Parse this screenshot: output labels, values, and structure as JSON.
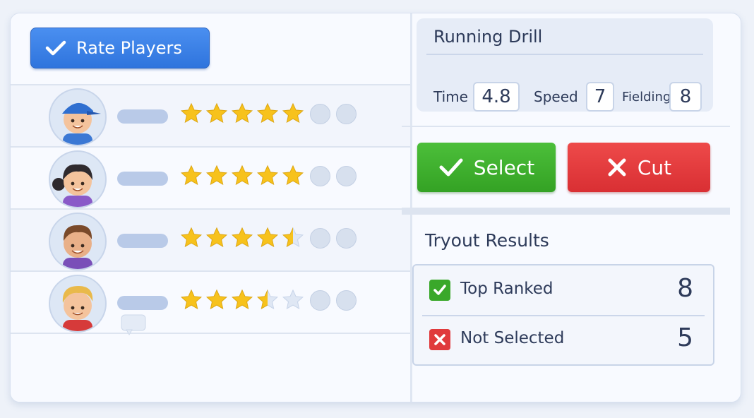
{
  "rate_button": {
    "label": "Rate Players",
    "icon": "checkmark-icon"
  },
  "players": [
    {
      "avatar": "boy-blue-cap-avatar",
      "rating": 5
    },
    {
      "avatar": "girl-pigtails-avatar",
      "rating": 5
    },
    {
      "avatar": "boy-brown-hair-avatar",
      "rating": 4.5
    },
    {
      "avatar": "boy-blond-hair-avatar",
      "rating": 3.5
    }
  ],
  "rating_scale": {
    "stars": 5,
    "extra_dots": 2
  },
  "drill": {
    "title": "Running Drill",
    "stats": [
      {
        "label": "Time",
        "value": "4.8"
      },
      {
        "label": "Speed",
        "value": "7"
      },
      {
        "label": "Fielding",
        "value": "8"
      }
    ]
  },
  "actions": {
    "select_label": "Select",
    "cut_label": "Cut"
  },
  "results": {
    "title": "Tryout Results",
    "rows": [
      {
        "label": "Top Ranked",
        "count": "8",
        "icon": "check-badge-icon",
        "color": "#3aa82a"
      },
      {
        "label": "Not Selected",
        "count": "5",
        "icon": "x-badge-icon",
        "color": "#e03a3c"
      }
    ]
  },
  "colors": {
    "primary_blue": "#2f74dd",
    "select_green": "#34a224",
    "cut_red": "#d92f33",
    "star_gold": "#f7c21c"
  }
}
